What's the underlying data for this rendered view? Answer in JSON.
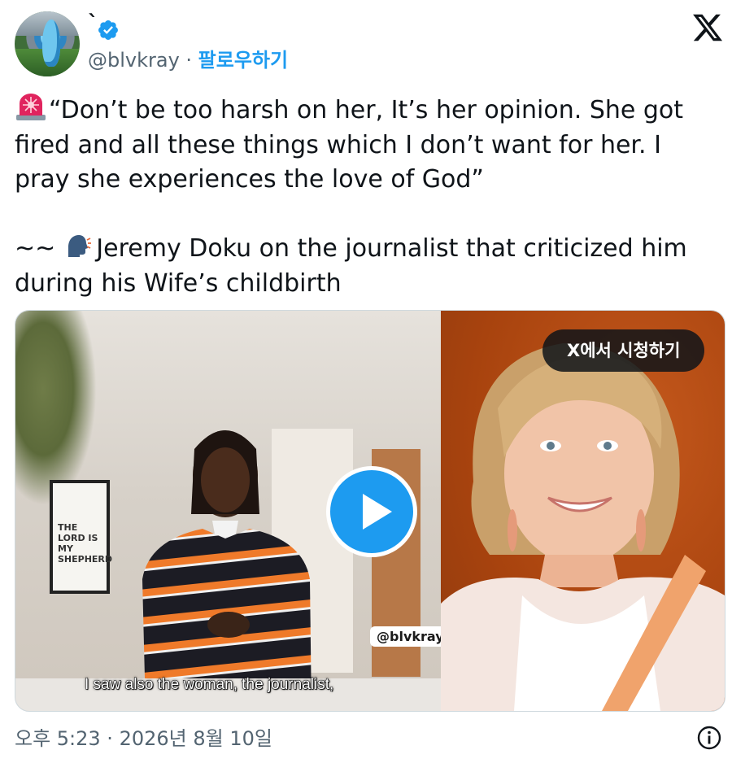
{
  "author": {
    "display_name": "`",
    "handle": "@blvkray",
    "separator": " · ",
    "follow_label": "팔로우하기",
    "verified_color": "#1d9bf0"
  },
  "tweet": {
    "quote_line": "“Don’t be too harsh on her, It’s her opinion. She got fired and all these things which I don’t want for her. I pray she experiences the love of God”",
    "tilde": "~~",
    "attribution": "Jeremy Doku on the journalist that criticized him during his Wife’s childbirth",
    "emojis": [
      "rotating-light-emoji",
      "speaking-head-emoji"
    ]
  },
  "media": {
    "poster_text": "THE LORD IS MY SHEPHERD",
    "watermark": "@blvkray",
    "subtitle": "I saw also the woman, the journalist,",
    "watch_on_x": "X에서 시청하기",
    "play_color": "#1d9bf0"
  },
  "footer": {
    "timestamp": "오후 5:23 · 2026년 8월 10일"
  },
  "icons": [
    "x-logo-icon",
    "verified-badge-icon",
    "play-icon",
    "info-icon"
  ]
}
